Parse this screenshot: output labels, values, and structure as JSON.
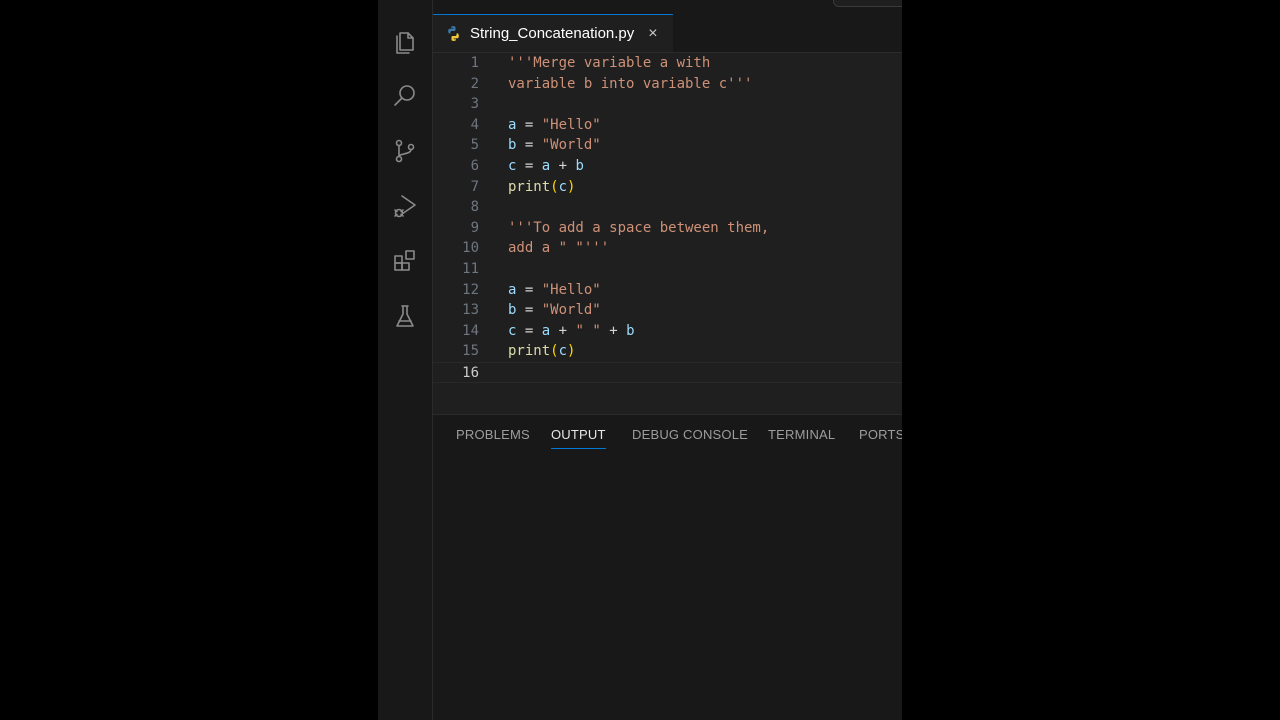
{
  "activity_bar": {
    "items": [
      {
        "name": "explorer-icon"
      },
      {
        "name": "search-icon"
      },
      {
        "name": "source-control-icon"
      },
      {
        "name": "run-debug-icon"
      },
      {
        "name": "extensions-icon"
      },
      {
        "name": "testing-icon"
      }
    ]
  },
  "tab": {
    "label": "String_Concatenation.py",
    "close": "×",
    "icon": "python-icon"
  },
  "editor": {
    "active_line": "16",
    "lines": [
      {
        "num": "1",
        "tokens": [
          {
            "t": "'''Merge variable a with",
            "c": "str"
          }
        ]
      },
      {
        "num": "2",
        "tokens": [
          {
            "t": "variable b into variable c'''",
            "c": "str"
          }
        ]
      },
      {
        "num": "3",
        "tokens": []
      },
      {
        "num": "4",
        "tokens": [
          {
            "t": "a",
            "c": "var"
          },
          {
            "t": " = ",
            "c": "op"
          },
          {
            "t": "\"Hello\"",
            "c": "str"
          }
        ]
      },
      {
        "num": "5",
        "tokens": [
          {
            "t": "b",
            "c": "var"
          },
          {
            "t": " = ",
            "c": "op"
          },
          {
            "t": "\"World\"",
            "c": "str"
          }
        ]
      },
      {
        "num": "6",
        "tokens": [
          {
            "t": "c",
            "c": "var"
          },
          {
            "t": " = ",
            "c": "op"
          },
          {
            "t": "a",
            "c": "var"
          },
          {
            "t": " + ",
            "c": "op"
          },
          {
            "t": "b",
            "c": "var"
          }
        ]
      },
      {
        "num": "7",
        "tokens": [
          {
            "t": "print",
            "c": "fn"
          },
          {
            "t": "(",
            "c": "br"
          },
          {
            "t": "c",
            "c": "var"
          },
          {
            "t": ")",
            "c": "br"
          }
        ]
      },
      {
        "num": "8",
        "tokens": []
      },
      {
        "num": "9",
        "tokens": [
          {
            "t": "'''To add a space between them,",
            "c": "str"
          }
        ]
      },
      {
        "num": "10",
        "tokens": [
          {
            "t": "add a \" \"'''",
            "c": "str"
          }
        ]
      },
      {
        "num": "11",
        "tokens": []
      },
      {
        "num": "12",
        "tokens": [
          {
            "t": "a",
            "c": "var"
          },
          {
            "t": " = ",
            "c": "op"
          },
          {
            "t": "\"Hello\"",
            "c": "str"
          }
        ]
      },
      {
        "num": "13",
        "tokens": [
          {
            "t": "b",
            "c": "var"
          },
          {
            "t": " = ",
            "c": "op"
          },
          {
            "t": "\"World\"",
            "c": "str"
          }
        ]
      },
      {
        "num": "14",
        "tokens": [
          {
            "t": "c",
            "c": "var"
          },
          {
            "t": " = ",
            "c": "op"
          },
          {
            "t": "a",
            "c": "var"
          },
          {
            "t": " + ",
            "c": "op"
          },
          {
            "t": "\" \"",
            "c": "str"
          },
          {
            "t": " + ",
            "c": "op"
          },
          {
            "t": "b",
            "c": "var"
          }
        ]
      },
      {
        "num": "15",
        "tokens": [
          {
            "t": "print",
            "c": "fn"
          },
          {
            "t": "(",
            "c": "br"
          },
          {
            "t": "c",
            "c": "var"
          },
          {
            "t": ")",
            "c": "br"
          }
        ]
      },
      {
        "num": "16",
        "tokens": []
      }
    ]
  },
  "panel": {
    "tabs": [
      {
        "label": "PROBLEMS",
        "active": false
      },
      {
        "label": "OUTPUT",
        "active": true
      },
      {
        "label": "DEBUG CONSOLE",
        "active": false
      },
      {
        "label": "TERMINAL",
        "active": false
      },
      {
        "label": "PORTS",
        "active": false
      }
    ]
  },
  "colors": {
    "accent": "#0078d4",
    "editor_bg": "#1f1f1f",
    "sidebar_bg": "#181818"
  }
}
